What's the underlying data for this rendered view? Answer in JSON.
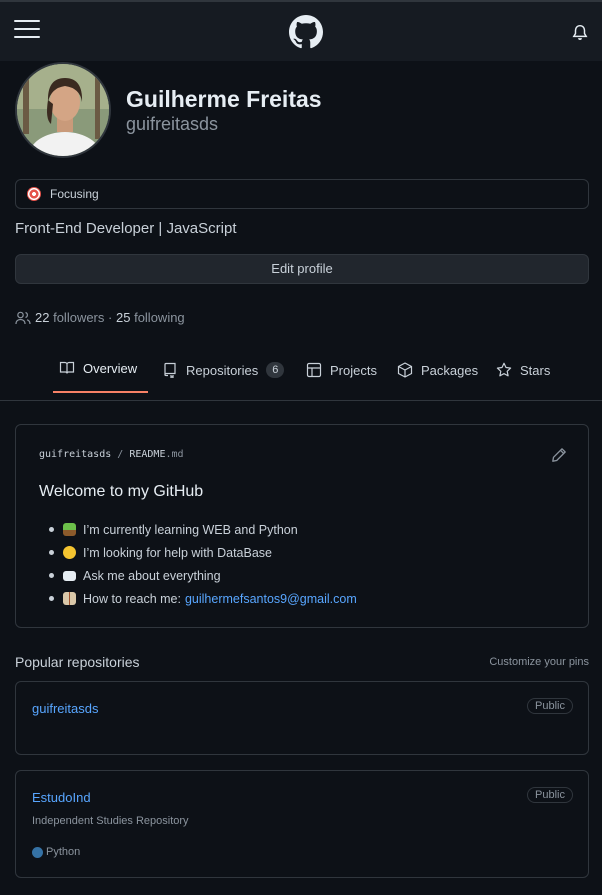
{
  "header": {
    "menu_icon": "hamburger-icon",
    "logo_icon": "github-logo-icon",
    "notification_icon": "bell-icon"
  },
  "profile": {
    "name": "Guilherme Freitas",
    "login": "guifreitasds",
    "status_emoji": "dart-emoji",
    "status": "Focusing",
    "bio": "Front-End Developer | JavaScript",
    "edit_label": "Edit profile",
    "followers_count": "22",
    "followers_label": "followers",
    "separator": "·",
    "following_count": "25",
    "following_label": "following"
  },
  "tabs": [
    {
      "label": "Overview",
      "icon": "book-icon",
      "active": true
    },
    {
      "label": "Repositories",
      "icon": "repo-icon",
      "count": "6"
    },
    {
      "label": "Projects",
      "icon": "table-icon"
    },
    {
      "label": "Packages",
      "icon": "package-icon"
    },
    {
      "label": "Stars",
      "icon": "star-icon"
    }
  ],
  "readme": {
    "owner": "guifreitasds",
    "sep": "/",
    "file": "README",
    "ext": ".md",
    "title": "Welcome to my GitHub",
    "items": [
      {
        "text": "I’m currently learning WEB and Python",
        "emoji": "seedling-emoji"
      },
      {
        "text": "I’m looking for help with DataBase",
        "emoji": "thinking-emoji"
      },
      {
        "text": "Ask me about everything",
        "emoji": "speech-emoji"
      },
      {
        "text": "How to reach me:",
        "emoji": "book-emoji",
        "link": "guilhermefsantos9@gmail.com"
      }
    ]
  },
  "popular": {
    "title": "Popular repositories",
    "customize": "Customize your pins",
    "repos": [
      {
        "name": "guifreitasds",
        "visibility": "Public"
      },
      {
        "name": "EstudoInd",
        "visibility": "Public",
        "description": "Independent Studies Repository",
        "language": "Python",
        "language_color": "#3572a5"
      }
    ]
  },
  "colors": {
    "background": "#0d1117",
    "header": "#161b22",
    "border": "#30363d",
    "link": "#58a6ff",
    "tab_underline": "#f78166"
  }
}
